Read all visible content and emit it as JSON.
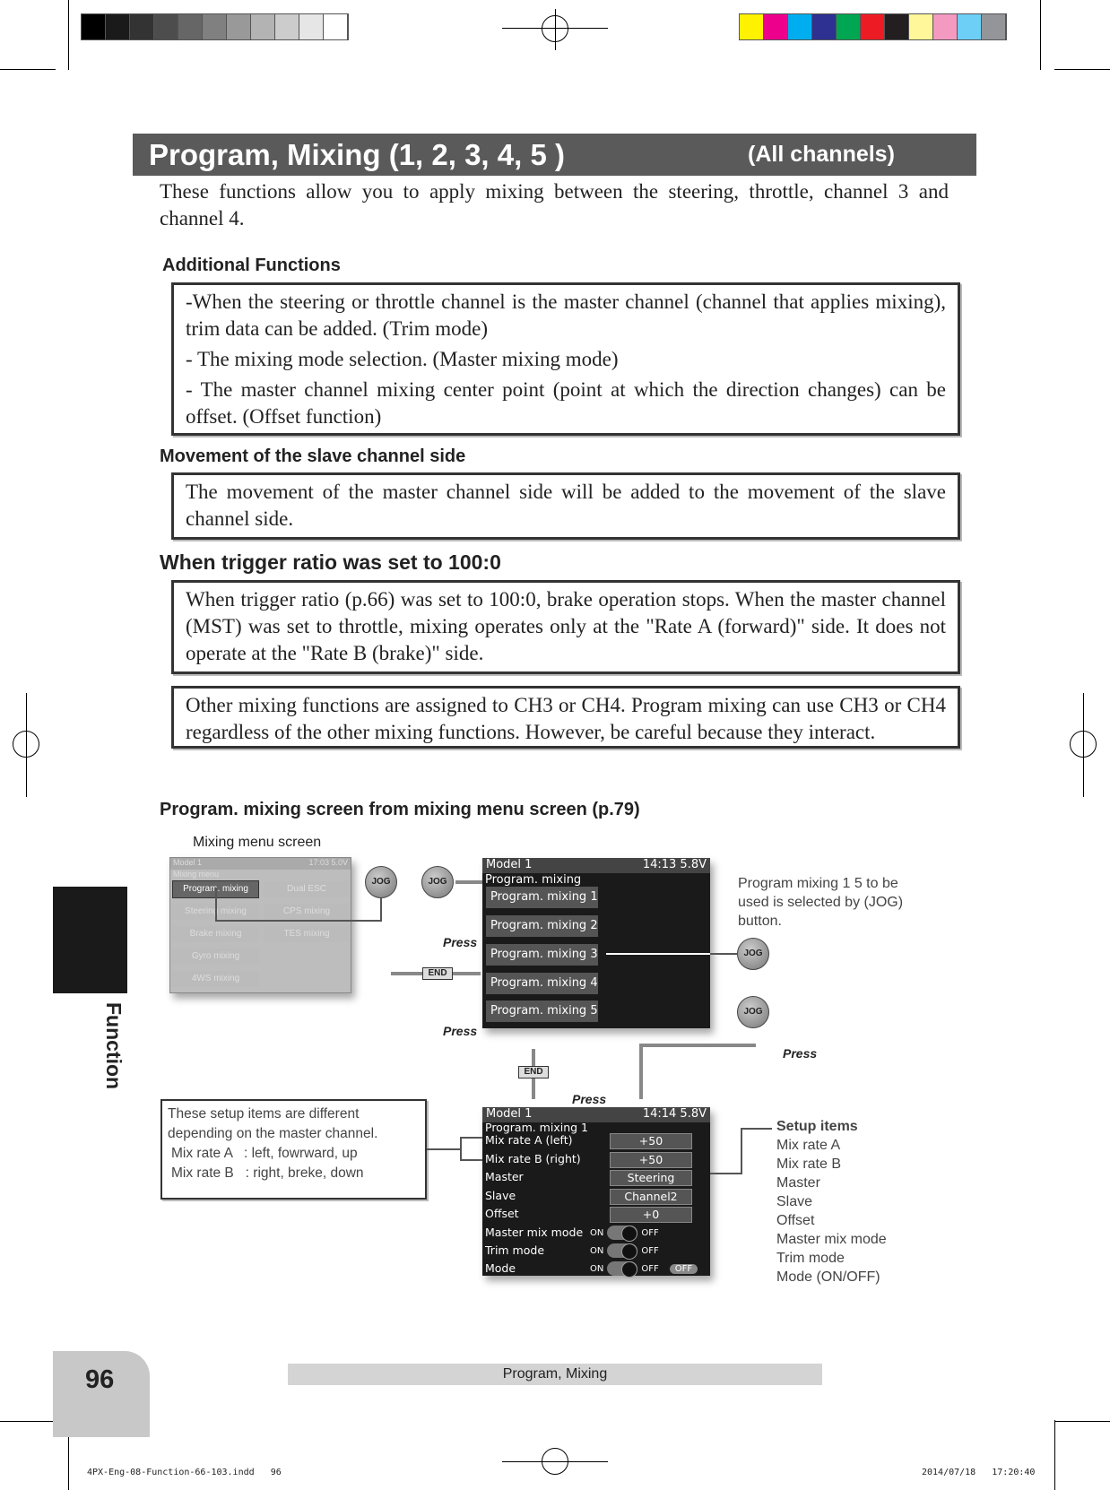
{
  "header": {
    "title": "Program, Mixing (1, 2, 3, 4, 5 )",
    "scope": "(All channels)"
  },
  "intro": "These functions allow you to apply mixing between the steering, throttle, channel 3 and channel 4.",
  "sections": {
    "additional": {
      "heading": "Additional Functions",
      "items": [
        "-When the steering or throttle channel is the master channel (channel that applies mixing), trim data can be added. (Trim mode)",
        "- The mixing mode selection. (Master mixing mode)",
        "- The master channel mixing center point (point at which the direction changes) can be offset. (Offset function)"
      ]
    },
    "slave": {
      "heading": "Movement of the slave channel side",
      "text": "The movement of the master channel side will be added to the movement of the slave channel side."
    },
    "trigger": {
      "heading": "When trigger ratio was set to 100:0",
      "text": "When trigger ratio (p.66) was set to 100:0, brake operation stops. When the master channel (MST) was set to throttle, mixing operates only at the \"Rate A (forward)\" side. It does not operate at the \"Rate B (brake)\" side."
    },
    "other": {
      "text": "Other mixing functions are assigned to CH3 or CH4. Program mixing can use CH3 or CH4 regardless of the other mixing functions. However, be careful because they interact."
    }
  },
  "diagram": {
    "heading": "Program. mixing screen from mixing menu screen (p.79)",
    "menu_label": "Mixing menu screen",
    "menu_screen": {
      "model": "Model 1",
      "status": "17:03 5.0V",
      "title": "Mixing menu",
      "items": [
        "Program. mixing",
        "Dual ESC",
        "Steering mixing",
        "CPS mixing",
        "Brake mixing",
        "TES mixing",
        "Gyro mixing",
        "4WS mixing"
      ]
    },
    "list_screen": {
      "model": "Model 1",
      "status": "14:13 5.8V",
      "title": "Program. mixing",
      "items": [
        "Program. mixing 1",
        "Program. mixing 2",
        "Program. mixing 3",
        "Program. mixing 4",
        "Program. mixing 5"
      ]
    },
    "select_note": "Program mixing 1 5 to be used is selected by (JOG) button.",
    "buttons": {
      "jog": "JOG",
      "end": "END",
      "press": "Press"
    },
    "detail_screen": {
      "model": "Model 1",
      "status": "14:14 5.8V",
      "title": "Program. mixing 1",
      "rows": [
        {
          "label": "Mix rate A (left)",
          "value": "+50"
        },
        {
          "label": "Mix rate B (right)",
          "value": "+50"
        },
        {
          "label": "Master",
          "value": "Steering"
        },
        {
          "label": "Slave",
          "value": "Channel2"
        },
        {
          "label": "Offset",
          "value": "+0"
        }
      ],
      "toggles": [
        {
          "label": "Master mix mode",
          "on": "ON",
          "off": "OFF"
        },
        {
          "label": "Trim mode",
          "on": "ON",
          "off": "OFF"
        },
        {
          "label": "Mode",
          "on": "ON",
          "off": "OFF",
          "state": "OFF"
        }
      ]
    },
    "note": {
      "text": "These setup items are different depending on the master channel.",
      "lines": [
        "Mix rate A   : left, fowrward, up",
        "Mix rate B   : right, breke, down"
      ]
    },
    "setup": {
      "heading": "Setup items",
      "items": [
        "Mix rate A",
        "Mix rate B",
        "Master",
        "Slave",
        "Offset",
        "Master mix mode",
        "Trim mode",
        "Mode (ON/OFF)"
      ]
    }
  },
  "side_tab": "Function",
  "footer": {
    "page": "96",
    "title": "Program, Mixing",
    "slug_left": "4PX-Eng-08-Function-66-103.indd   96",
    "slug_right": "2014/07/18   17:20:40"
  },
  "colors": {
    "title_bar": "#5a5a5a",
    "grays": [
      "#000000",
      "#1a1a1a",
      "#333333",
      "#4d4d4d",
      "#666666",
      "#808080",
      "#999999",
      "#b3b3b3",
      "#cccccc",
      "#e6e6e6",
      "#ffffff"
    ],
    "process": [
      "#fff200",
      "#ec008c",
      "#00aeef",
      "#2e3192",
      "#00a651",
      "#ed1c24",
      "#231f20",
      "#fff799",
      "#f49ac1",
      "#6dcff6",
      "#939598"
    ]
  }
}
